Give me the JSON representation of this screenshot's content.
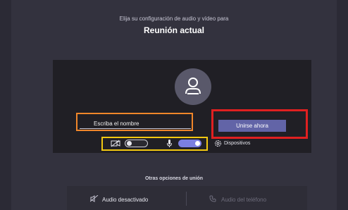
{
  "header": {
    "subtitle": "Elija su configuración de audio y vídeo para",
    "meeting_title": "Reunión actual"
  },
  "name_field": {
    "value": "",
    "placeholder": "Escriba el nombre"
  },
  "join_button": {
    "label": "Unirse ahora"
  },
  "controls": {
    "camera_on": false,
    "mic_on": true,
    "devices_label": "Dispositivos"
  },
  "other_options": {
    "title": "Otras opciones de unión",
    "audio_off_label": "Audio desactivado",
    "phone_audio_label": "Audio del teléfono"
  },
  "colors": {
    "accent": "#6264a7",
    "highlight_orange": "#f0862a",
    "highlight_red": "#e02020",
    "highlight_yellow": "#f2c811"
  },
  "icons": [
    "person-icon",
    "camera-off-icon",
    "microphone-icon",
    "gear-icon",
    "speaker-off-icon",
    "phone-icon"
  ]
}
